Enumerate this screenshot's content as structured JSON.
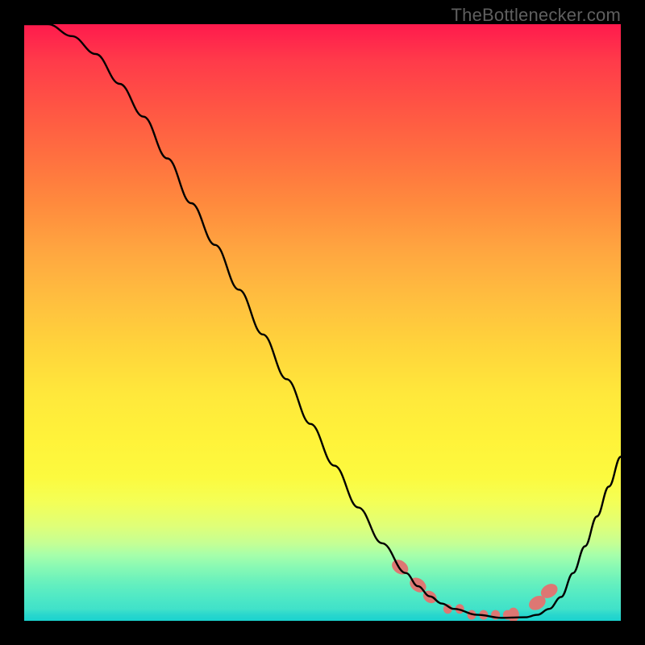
{
  "watermark": "TheBottlenecker.com",
  "chart_data": {
    "type": "line",
    "title": "",
    "xlabel": "",
    "ylabel": "",
    "xlim": [
      0,
      100
    ],
    "ylim": [
      0,
      100
    ],
    "series": [
      {
        "name": "curve",
        "x": [
          0,
          4,
          8,
          12,
          16,
          20,
          24,
          28,
          32,
          36,
          40,
          44,
          48,
          52,
          56,
          60,
          64,
          66,
          68,
          70,
          72,
          76,
          80,
          84,
          86,
          88,
          90,
          92,
          94,
          96,
          98,
          100
        ],
        "values": [
          100,
          100,
          98,
          95,
          90,
          84.5,
          77.5,
          70,
          63,
          55.5,
          48,
          40.5,
          33,
          26,
          19,
          13,
          8,
          5.8,
          4.1,
          2.9,
          2,
          1,
          0.5,
          0.6,
          1,
          2,
          4,
          8,
          12.5,
          17.5,
          22.5,
          27.5
        ]
      }
    ],
    "markers": {
      "name": "marker-cluster",
      "color": "#dd7773",
      "points": [
        {
          "x": 63,
          "y": 9
        },
        {
          "x": 66,
          "y": 6
        },
        {
          "x": 68,
          "y": 4
        },
        {
          "x": 71,
          "y": 2
        },
        {
          "x": 73,
          "y": 2
        },
        {
          "x": 75,
          "y": 1
        },
        {
          "x": 77,
          "y": 1
        },
        {
          "x": 79,
          "y": 1
        },
        {
          "x": 81,
          "y": 1
        },
        {
          "x": 82,
          "y": 1
        },
        {
          "x": 86,
          "y": 3
        },
        {
          "x": 88,
          "y": 5
        }
      ]
    },
    "background": "rainbow-gradient",
    "grid": false,
    "legend": false
  }
}
